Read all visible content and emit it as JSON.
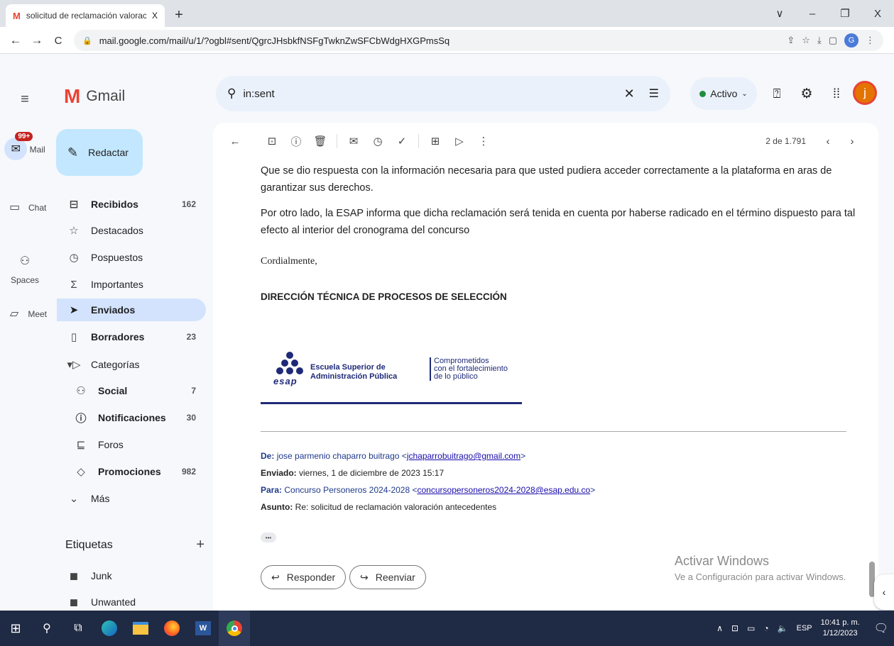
{
  "browser": {
    "tab_title": "solicitud de reclamación valorac",
    "url": "mail.google.com/mail/u/1/?ogbl#sent/QgrcJHsbkfNSFgTwknZwSFCbWdgHXGPmsSq",
    "new_tab": "+",
    "close": "X",
    "back": "←",
    "forward": "→",
    "reload": "C",
    "window_controls": [
      "∨",
      "–",
      "❐",
      "X"
    ],
    "profile": "G"
  },
  "gmail": {
    "brand": "Gmail",
    "search_value": "in:sent",
    "status": "Activo",
    "avatar": "j",
    "compose": "Redactar",
    "rail": [
      {
        "label": "Mail",
        "badge": "99+"
      },
      {
        "label": "Chat"
      },
      {
        "label": "Spaces"
      },
      {
        "label": "Meet"
      }
    ],
    "nav": [
      {
        "label": "Recibidos",
        "count": "162",
        "bold": true
      },
      {
        "label": "Destacados",
        "count": ""
      },
      {
        "label": "Pospuestos",
        "count": ""
      },
      {
        "label": "Importantes",
        "count": ""
      },
      {
        "label": "Enviados",
        "count": "",
        "active": true
      },
      {
        "label": "Borradores",
        "count": "23",
        "bold": true
      },
      {
        "label": "Categorías",
        "count": ""
      },
      {
        "label": "Social",
        "count": "7",
        "bold": true
      },
      {
        "label": "Notificaciones",
        "count": "30",
        "bold": true
      },
      {
        "label": "Foros",
        "count": ""
      },
      {
        "label": "Promociones",
        "count": "982",
        "bold": true
      },
      {
        "label": "Más",
        "count": ""
      }
    ],
    "labels_header": "Etiquetas",
    "labels_add": "+",
    "labels": [
      "Junk",
      "Unwanted"
    ],
    "pager": "2 de 1.791"
  },
  "email": {
    "para1": "Que se dio respuesta con la información necesaria para que usted pudiera acceder correctamente a la plataforma en aras de garantizar sus derechos.",
    "para2": "Por otro lado, la ESAP informa que dicha reclamación será tenida en cuenta por haberse radicado en el término dispuesto para tal efecto al interior del cronograma del concurso",
    "closing": "Cordialmente,",
    "signature": "DIRECCIÓN TÉCNICA DE PROCESOS DE SELECCIÓN",
    "logo": {
      "name_line1": "Escuela Superior de",
      "name_line2": "Administración Pública",
      "abbr": "esap",
      "tag_line1": "Comprometidos",
      "tag_line2": "con el fortalecimiento",
      "tag_line3": "de lo público"
    },
    "from_label": "De:",
    "from_name": "jose parmenio chaparro buitrago <",
    "from_email": "jchaparrobuitrago@gmail.com",
    "from_end": ">",
    "sent_label": "Enviado:",
    "sent_value": "viernes, 1 de diciembre de 2023 15:17",
    "to_label": "Para:",
    "to_name": "Concurso Personeros 2024-2028 <",
    "to_email": "concursopersoneros2024-2028@esap.edu.co",
    "to_end": ">",
    "subject_label": "Asunto:",
    "subject_value": "Re: solicitud de reclamación valoración antecedentes",
    "ellipsis": "•••",
    "reply": "Responder",
    "forward": "Reenviar"
  },
  "watermark": {
    "line1": "Activar Windows",
    "line2": "Ve a Configuración para activar Windows."
  },
  "taskbar": {
    "lang": "ESP",
    "time": "10:41 p. m.",
    "date": "1/12/2023"
  },
  "colors": {
    "gmail_red": "#ea4335",
    "active_bg": "#d3e3fd",
    "compose_bg": "#c2e7ff",
    "taskbar": "#1f2a44",
    "esap_blue": "#1e2a78"
  }
}
